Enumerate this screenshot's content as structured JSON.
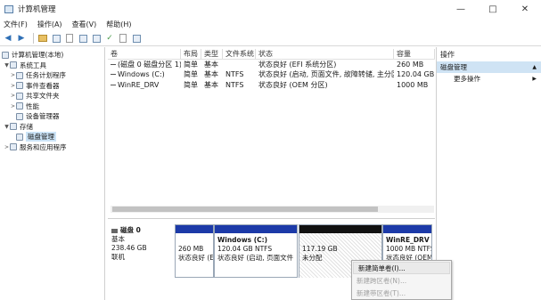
{
  "window": {
    "title": "计算机管理",
    "minimize": "—",
    "maximize": "□",
    "close": "✕"
  },
  "menu": [
    "文件(F)",
    "操作(A)",
    "查看(V)",
    "帮助(H)"
  ],
  "tree": {
    "root": "计算机管理(本地)",
    "system_tools": "系统工具",
    "task_scheduler": "任务计划程序",
    "event_viewer": "事件查看器",
    "shared_folders": "共享文件夹",
    "performance": "性能",
    "device_manager": "设备管理器",
    "storage": "存储",
    "disk_management": "磁盘管理",
    "services": "服务和应用程序"
  },
  "volume_table": {
    "headers": [
      "卷",
      "布局",
      "类型",
      "文件系统",
      "状态",
      "容量"
    ],
    "rows": [
      [
        "(磁盘 0 磁盘分区 1)",
        "简单",
        "基本",
        "",
        "状态良好 (EFI 系统分区)",
        "260 MB"
      ],
      [
        "Windows (C:)",
        "简单",
        "基本",
        "NTFS",
        "状态良好 (启动, 页面文件, 故障转储, 主分区)",
        "120.04 GB"
      ],
      [
        "WinRE_DRV",
        "简单",
        "基本",
        "NTFS",
        "状态良好 (OEM 分区)",
        "1000 MB"
      ]
    ]
  },
  "actions": {
    "title": "操作",
    "section": "磁盘管理",
    "more": "更多操作",
    "up_arrow": "▲",
    "right_arrow": "▶"
  },
  "disk": {
    "name": "磁盘 0",
    "type": "基本",
    "size": "238.46 GB",
    "status": "联机",
    "partitions": [
      {
        "name": "",
        "size": "260 MB",
        "status": "状态良好 (EFI"
      },
      {
        "name": "Windows (C:)",
        "size": "120.04 GB NTFS",
        "status": "状态良好 (启动, 页面文件"
      },
      {
        "name": "",
        "size": "117.19 GB",
        "status": "未分配"
      },
      {
        "name": "WinRE_DRV",
        "size": "1000 MB NTFS",
        "status": "状态良好 (OEM"
      }
    ]
  },
  "context_menu": [
    "新建简单卷(I)...",
    "新建跨区卷(N)...",
    "新建带区卷(T)..."
  ]
}
